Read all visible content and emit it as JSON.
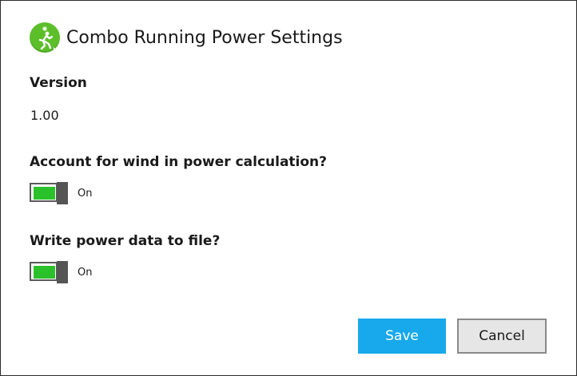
{
  "dialog": {
    "title": "Combo Running Power Settings",
    "app_icon": "running-figure-icon",
    "accent_color": "#17a9eb",
    "icon_color": "#5cbf2a"
  },
  "version": {
    "label": "Version",
    "value": "1.00"
  },
  "settings": [
    {
      "label": "Account for wind in power calculation?",
      "state": "On",
      "enabled": true,
      "toggle_color": "#2bc12b"
    },
    {
      "label": "Write power data to file?",
      "state": "On",
      "enabled": true,
      "toggle_color": "#2bc12b"
    }
  ],
  "buttons": {
    "save_label": "Save",
    "cancel_label": "Cancel"
  }
}
